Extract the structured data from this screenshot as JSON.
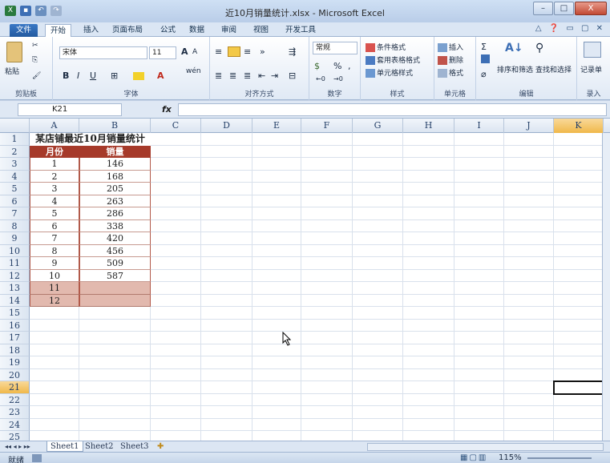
{
  "window": {
    "title": "近10月销量统计.xlsx - Microsoft Excel",
    "minimize": "–",
    "maximize": "□",
    "close": "X"
  },
  "ribbon_tabs": [
    "文件",
    "开始",
    "插入",
    "页面布局",
    "公式",
    "数据",
    "审阅",
    "视图",
    "开发工具"
  ],
  "ribbon": {
    "clipboard": {
      "paste": "粘贴",
      "label": "剪贴板"
    },
    "font": {
      "name": "宋体",
      "size": "11",
      "bold": "B",
      "italic": "I",
      "underline": "U",
      "grow": "A",
      "shrink": "A",
      "label": "字体",
      "wen": "wén"
    },
    "alignment": {
      "label": "对齐方式"
    },
    "number": {
      "format": "常规",
      "percent": "%",
      "comma": ",",
      "label": "数字"
    },
    "styles": {
      "conditional": "条件格式",
      "table": "套用表格格式",
      "cell": "单元格样式",
      "label": "样式"
    },
    "cells": {
      "insert": "插入",
      "delete": "删除",
      "format": "格式",
      "label": "单元格"
    },
    "editing": {
      "sigma": "Σ",
      "sortfilter": "排序和筛选",
      "findselect": "查找和选择",
      "label": "编辑"
    },
    "record": {
      "button": "记录单",
      "label": "录入"
    }
  },
  "formula_bar": {
    "name_box": "K21",
    "fx": "fx",
    "formula": ""
  },
  "columns": [
    "A",
    "B",
    "C",
    "D",
    "E",
    "F",
    "G",
    "H",
    "I",
    "J",
    "K"
  ],
  "selected_column": "K",
  "rows": [
    "1",
    "2",
    "3",
    "4",
    "5",
    "6",
    "7",
    "8",
    "9",
    "10",
    "11",
    "12",
    "13",
    "14",
    "15",
    "16",
    "17",
    "18",
    "19",
    "20",
    "21",
    "22",
    "23",
    "24",
    "25"
  ],
  "selected_row": "21",
  "sheet": {
    "title": "某店铺最近10月销量统计",
    "headers": [
      "月份",
      "销量"
    ],
    "data": [
      [
        "1",
        "146"
      ],
      [
        "2",
        "168"
      ],
      [
        "3",
        "205"
      ],
      [
        "4",
        "263"
      ],
      [
        "5",
        "286"
      ],
      [
        "6",
        "338"
      ],
      [
        "7",
        "420"
      ],
      [
        "8",
        "456"
      ],
      [
        "9",
        "509"
      ],
      [
        "10",
        "587"
      ],
      [
        "11",
        ""
      ],
      [
        "12",
        ""
      ]
    ]
  },
  "sheet_tabs": [
    "Sheet1",
    "Sheet2",
    "Sheet3"
  ],
  "status": {
    "ready": "就绪",
    "zoom": "115%"
  }
}
